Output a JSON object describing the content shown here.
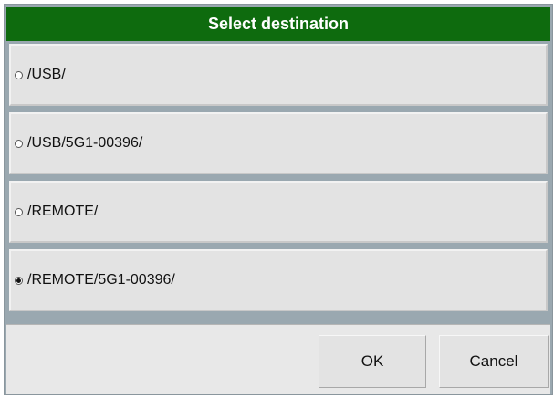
{
  "dialog": {
    "title": "Select destination",
    "options": [
      {
        "label": "/USB/",
        "selected": false
      },
      {
        "label": "/USB/5G1-00396/",
        "selected": false
      },
      {
        "label": "/REMOTE/",
        "selected": false
      },
      {
        "label": "/REMOTE/5G1-00396/",
        "selected": true
      }
    ],
    "buttons": {
      "ok_label": "OK",
      "cancel_label": "Cancel"
    }
  },
  "colors": {
    "title_bar": "#0e6b0e",
    "title_text": "#ffffff",
    "option_background": "#e3e3e3",
    "frame": "#9aa8b0"
  }
}
